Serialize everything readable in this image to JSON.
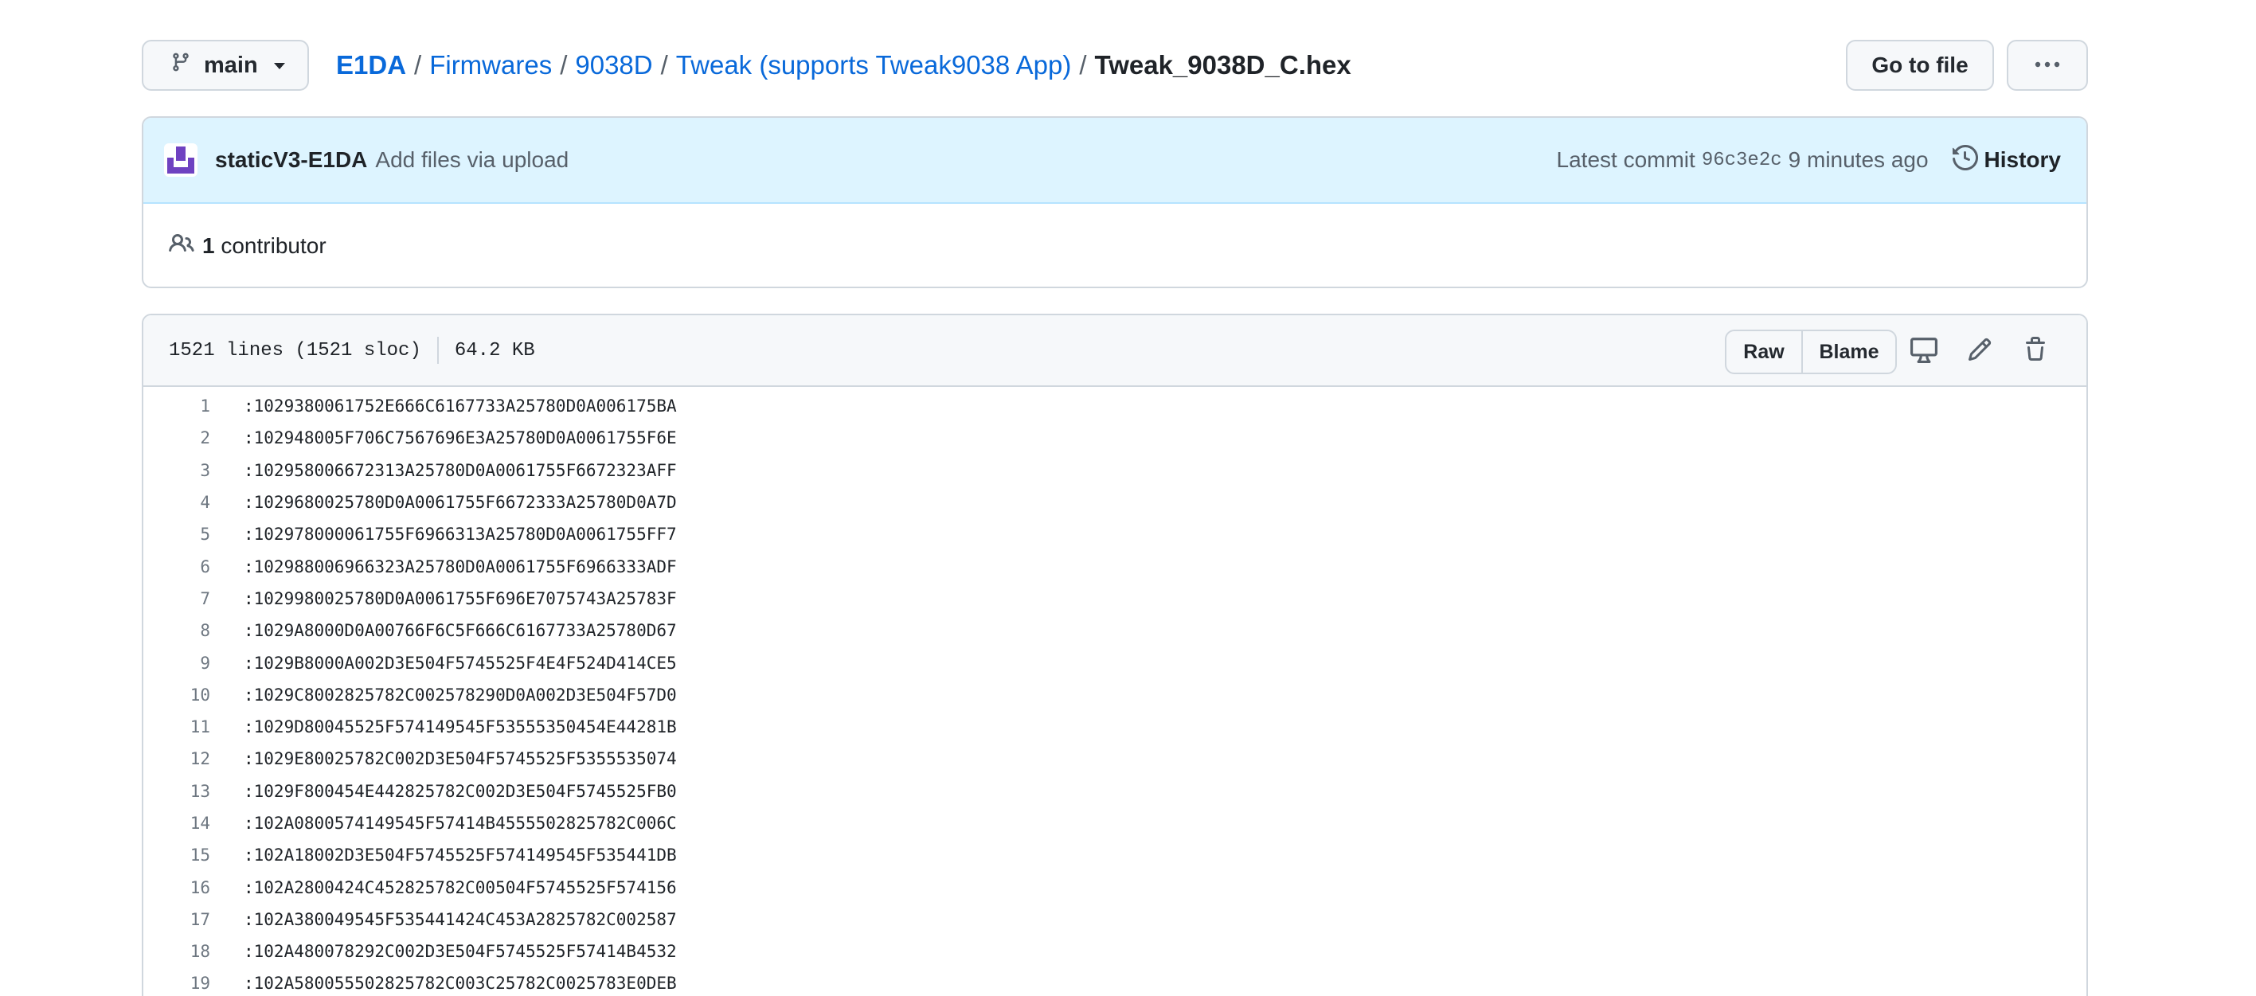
{
  "branch": {
    "label": "main"
  },
  "breadcrumb": {
    "repo": "E1DA",
    "path": [
      "Firmwares",
      "9038D",
      "Tweak (supports Tweak9038 App)"
    ],
    "separator": "/",
    "file": "Tweak_9038D_C.hex"
  },
  "actions": {
    "goto_file": "Go to file"
  },
  "commit": {
    "author": "staticV3-E1DA",
    "message": "Add files via upload",
    "latest_label": "Latest commit",
    "sha": "96c3e2c",
    "time": "9 minutes ago",
    "history_label": "History",
    "avatar_color": "#6f42c1"
  },
  "contributors": {
    "count": "1",
    "label": "contributor"
  },
  "file": {
    "lines_info": "1521 lines (1521 sloc)",
    "size": "64.2 KB",
    "raw_label": "Raw",
    "blame_label": "Blame"
  },
  "code_lines": [
    {
      "num": "1",
      "text": ":1029380061752E666C6167733A25780D0A006175BA"
    },
    {
      "num": "2",
      "text": ":102948005F706C7567696E3A25780D0A0061755F6E"
    },
    {
      "num": "3",
      "text": ":102958006672313A25780D0A0061755F6672323AFF"
    },
    {
      "num": "4",
      "text": ":1029680025780D0A0061755F6672333A25780D0A7D"
    },
    {
      "num": "5",
      "text": ":102978000061755F6966313A25780D0A0061755FF7"
    },
    {
      "num": "6",
      "text": ":102988006966323A25780D0A0061755F6966333ADF"
    },
    {
      "num": "7",
      "text": ":1029980025780D0A0061755F696E7075743A25783F"
    },
    {
      "num": "8",
      "text": ":1029A8000D0A00766F6C5F666C6167733A25780D67"
    },
    {
      "num": "9",
      "text": ":1029B8000A002D3E504F5745525F4E4F524D414CE5"
    },
    {
      "num": "10",
      "text": ":1029C8002825782C002578290D0A002D3E504F57D0"
    },
    {
      "num": "11",
      "text": ":1029D80045525F574149545F53555350454E44281B"
    },
    {
      "num": "12",
      "text": ":1029E80025782C002D3E504F5745525F5355535074"
    },
    {
      "num": "13",
      "text": ":1029F800454E442825782C002D3E504F5745525FB0"
    },
    {
      "num": "14",
      "text": ":102A0800574149545F57414B4555502825782C006C"
    },
    {
      "num": "15",
      "text": ":102A18002D3E504F5745525F574149545F535441DB"
    },
    {
      "num": "16",
      "text": ":102A2800424C452825782C00504F5745525F574156"
    },
    {
      "num": "17",
      "text": ":102A380049545F535441424C453A2825782C002587"
    },
    {
      "num": "18",
      "text": ":102A480078292C002D3E504F5745525F57414B4532"
    },
    {
      "num": "19",
      "text": ":102A580055502825782C003C25782C0025783E0DEB"
    }
  ]
}
